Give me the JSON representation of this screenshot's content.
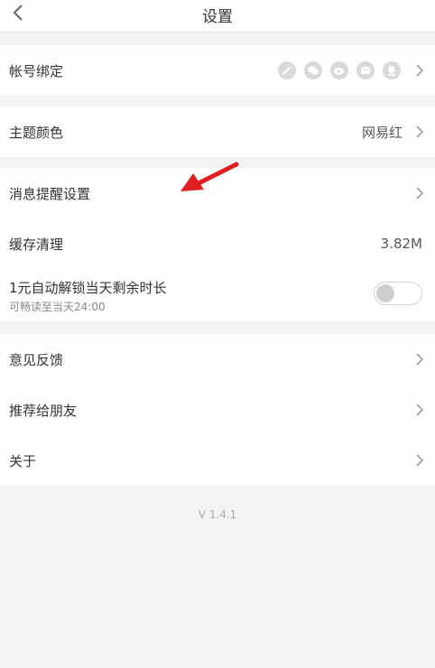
{
  "header": {
    "title": "设置"
  },
  "account": {
    "label": "帐号绑定",
    "icons": [
      "pencil-icon",
      "wechat-icon",
      "weibo-icon",
      "mail-icon",
      "qq-icon"
    ]
  },
  "theme": {
    "label": "主题颜色",
    "value": "网易红"
  },
  "settings": {
    "notification": {
      "label": "消息提醒设置"
    },
    "cache": {
      "label": "缓存清理",
      "value": "3.82M"
    },
    "unlock": {
      "label": "1元自动解锁当天剩余时长",
      "sub": "可畅读至当天24:00",
      "toggle_on": false
    }
  },
  "more": {
    "feedback": {
      "label": "意见反馈"
    },
    "recommend": {
      "label": "推荐给朋友"
    },
    "about": {
      "label": "关于"
    }
  },
  "version": "V 1.4.1",
  "colors": {
    "accent": "#e02020",
    "background": "#f3f3f3",
    "icon_gray": "#d9d9d9"
  }
}
